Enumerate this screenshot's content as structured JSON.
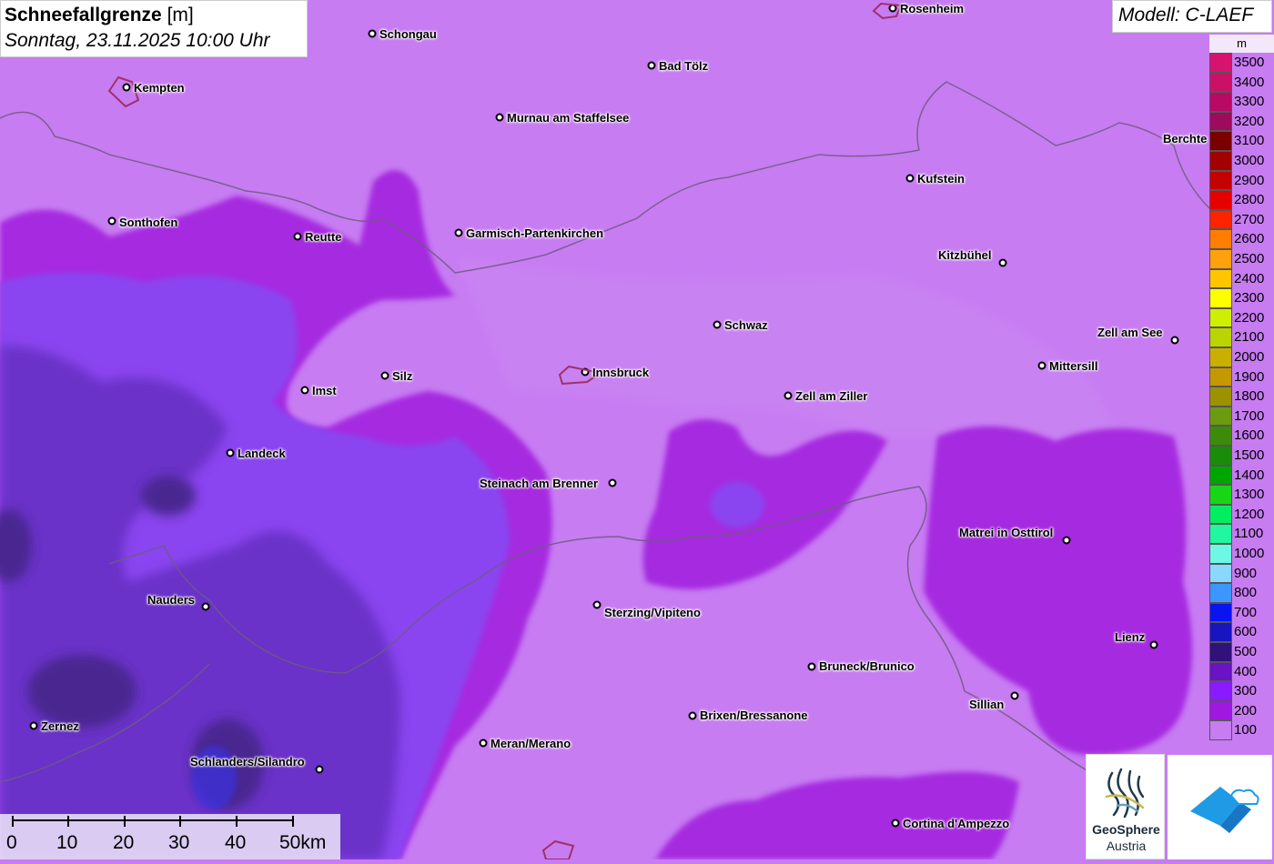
{
  "title": {
    "name": "Schneefallgrenze",
    "unit": "[m]",
    "subtitle": "Sonntag, 23.11.2025 10:00 Uhr"
  },
  "model": "Modell: C-LAEF",
  "legend": {
    "unit": "m",
    "levels": [
      {
        "label": "3500",
        "color": "#d6136f"
      },
      {
        "label": "3400",
        "color": "#cc1068"
      },
      {
        "label": "3300",
        "color": "#b80a65"
      },
      {
        "label": "3200",
        "color": "#9e0a5e"
      },
      {
        "label": "3100",
        "color": "#7a0000"
      },
      {
        "label": "3000",
        "color": "#a30000"
      },
      {
        "label": "2900",
        "color": "#c40000"
      },
      {
        "label": "2800",
        "color": "#e60000"
      },
      {
        "label": "2700",
        "color": "#ff2400"
      },
      {
        "label": "2600",
        "color": "#ff7d00"
      },
      {
        "label": "2500",
        "color": "#ffa10a"
      },
      {
        "label": "2400",
        "color": "#ffc600"
      },
      {
        "label": "2300",
        "color": "#ffff00"
      },
      {
        "label": "2200",
        "color": "#cdf000"
      },
      {
        "label": "2100",
        "color": "#b9d400"
      },
      {
        "label": "2000",
        "color": "#c9b000"
      },
      {
        "label": "1900",
        "color": "#c49800"
      },
      {
        "label": "1800",
        "color": "#9c9200"
      },
      {
        "label": "1700",
        "color": "#6c9a10"
      },
      {
        "label": "1600",
        "color": "#3c8c0a"
      },
      {
        "label": "1500",
        "color": "#198c0a"
      },
      {
        "label": "1400",
        "color": "#00a600"
      },
      {
        "label": "1300",
        "color": "#16d616"
      },
      {
        "label": "1200",
        "color": "#00ee60"
      },
      {
        "label": "1100",
        "color": "#20f7a0"
      },
      {
        "label": "1000",
        "color": "#6ff7e6"
      },
      {
        "label": "900",
        "color": "#8ad8ff"
      },
      {
        "label": "800",
        "color": "#3d96ff"
      },
      {
        "label": "700",
        "color": "#0a14f0"
      },
      {
        "label": "600",
        "color": "#1814c0"
      },
      {
        "label": "500",
        "color": "#30127a"
      },
      {
        "label": "400",
        "color": "#6a12c4"
      },
      {
        "label": "300",
        "color": "#8a1aff"
      },
      {
        "label": "200",
        "color": "#a018e0"
      },
      {
        "label": "100",
        "color": "#c77cf2"
      }
    ]
  },
  "cities": [
    {
      "name": "Rosenheim"
    },
    {
      "name": "Schongau"
    },
    {
      "name": "Bad Tölz"
    },
    {
      "name": "Kempten"
    },
    {
      "name": "Murnau am Staffelsee"
    },
    {
      "name": "Berchte"
    },
    {
      "name": "Kufstein"
    },
    {
      "name": "Sonthofen"
    },
    {
      "name": "Reutte"
    },
    {
      "name": "Garmisch-Partenkirchen"
    },
    {
      "name": "Kitzbühel"
    },
    {
      "name": "Schwaz"
    },
    {
      "name": "Zell am See"
    },
    {
      "name": "Mittersill"
    },
    {
      "name": "Imst"
    },
    {
      "name": "Silz"
    },
    {
      "name": "Innsbruck"
    },
    {
      "name": "Zell am Ziller"
    },
    {
      "name": "Landeck"
    },
    {
      "name": "Steinach am Brenner"
    },
    {
      "name": "Matrei in Osttirol"
    },
    {
      "name": "Nauders"
    },
    {
      "name": "Sterzing/Vipiteno"
    },
    {
      "name": "Lienz"
    },
    {
      "name": "Bruneck/Brunico"
    },
    {
      "name": "Sillian"
    },
    {
      "name": "Zernez"
    },
    {
      "name": "Brixen/Bressanone"
    },
    {
      "name": "Meran/Merano"
    },
    {
      "name": "Schlanders/Silandro"
    },
    {
      "name": "Cortina d'Ampezzo"
    }
  ],
  "scale": {
    "labels": [
      "0",
      "10",
      "20",
      "30",
      "40",
      "50km"
    ]
  },
  "logos": {
    "geosphere_line1": "GeoSphere",
    "geosphere_line2": "Austria"
  }
}
